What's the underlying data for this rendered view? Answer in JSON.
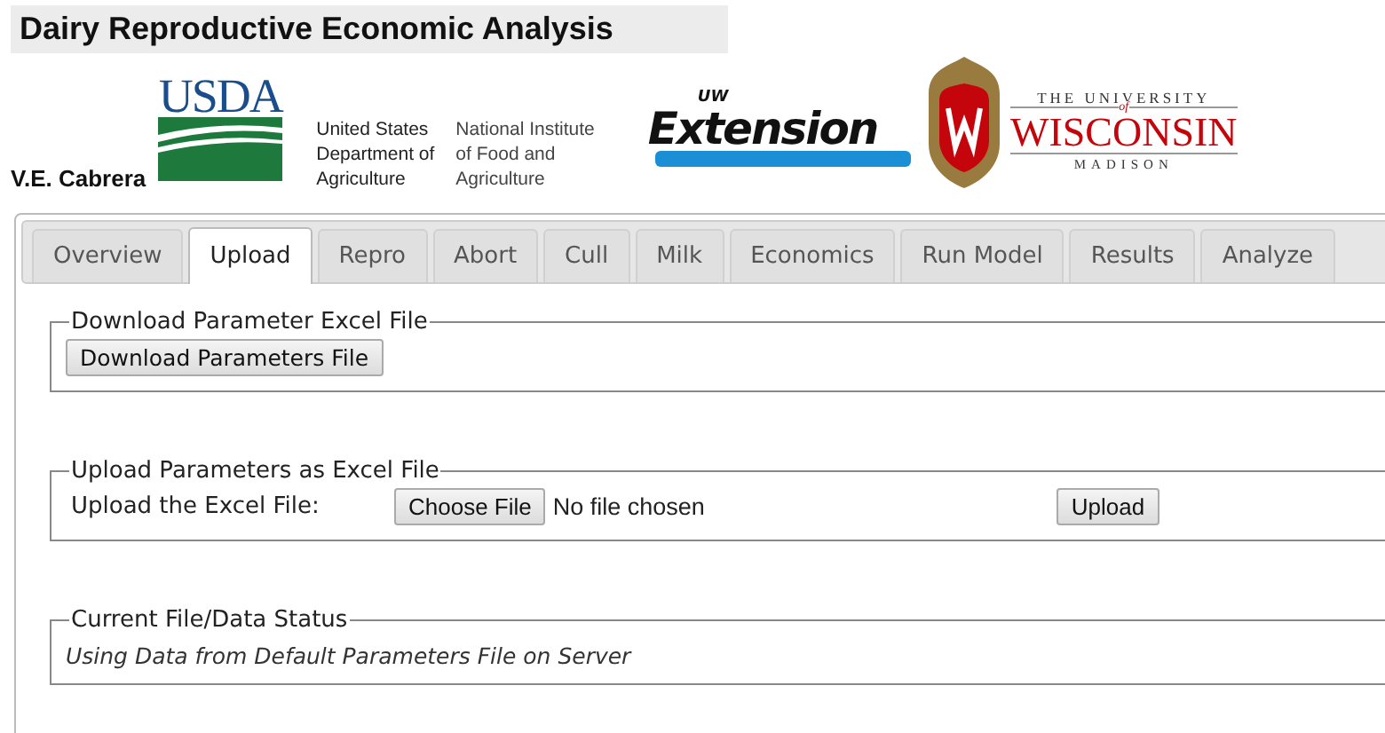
{
  "header": {
    "title": "Dairy Reproductive Economic Analysis",
    "author": "V.E. Cabrera"
  },
  "logos": {
    "usda": {
      "mark": "USDA",
      "agency_lines": [
        "United States",
        "Department of",
        "Agriculture"
      ],
      "institute_lines": [
        "National Institute",
        "of Food and",
        "Agriculture"
      ]
    },
    "extension": {
      "prefix": "UW",
      "name": "Extension"
    },
    "university": {
      "top": "THE UNIVERSITY",
      "of": "of",
      "name": "WISCONSIN",
      "campus": "MADISON"
    }
  },
  "tabs": [
    {
      "label": "Overview",
      "selected": false
    },
    {
      "label": "Upload",
      "selected": true
    },
    {
      "label": "Repro",
      "selected": false
    },
    {
      "label": "Abort",
      "selected": false
    },
    {
      "label": "Cull",
      "selected": false
    },
    {
      "label": "Milk",
      "selected": false
    },
    {
      "label": "Economics",
      "selected": false
    },
    {
      "label": "Run Model",
      "selected": false
    },
    {
      "label": "Results",
      "selected": false
    },
    {
      "label": "Analyze",
      "selected": false
    }
  ],
  "sections": [
    {
      "kind": "download",
      "legend": "Download Parameter Excel File",
      "button": "Download Parameters File"
    },
    {
      "kind": "upload",
      "legend": "Upload Parameters as Excel File",
      "label": "Upload the Excel File:",
      "file_button": "Choose File",
      "file_status": "No file chosen",
      "button": "Upload"
    },
    {
      "kind": "status",
      "legend": "Current File/Data Status",
      "text": "Using Data from Default Parameters File on Server"
    }
  ]
}
